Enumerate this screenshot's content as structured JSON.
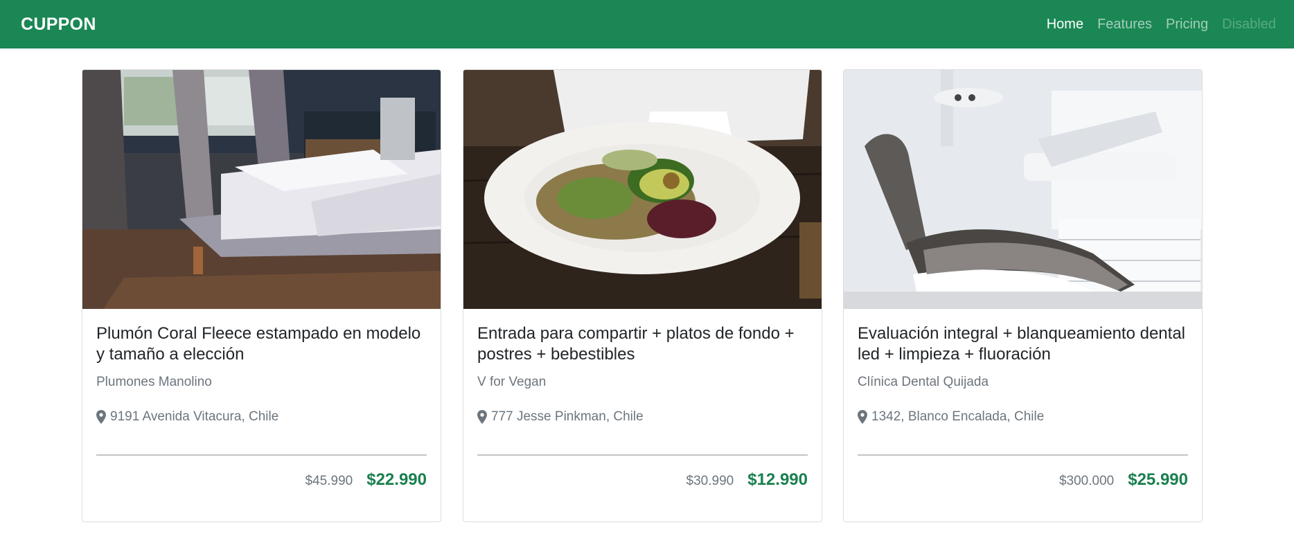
{
  "navbar": {
    "brand": "CUPPON",
    "links": [
      {
        "label": "Home",
        "state": "active"
      },
      {
        "label": "Features",
        "state": "normal"
      },
      {
        "label": "Pricing",
        "state": "normal"
      },
      {
        "label": "Disabled",
        "state": "disabled"
      }
    ],
    "background_color": "#1a8754"
  },
  "deals": [
    {
      "image": "bedroom-photo",
      "title": "Plumón Coral Fleece estampado en modelo y tamaño a elección",
      "merchant": "Plumones Manolino",
      "address": "9191 Avenida Vitacura, Chile",
      "price_old": "$45.990",
      "price_new": "$22.990"
    },
    {
      "image": "vegan-plate-photo",
      "title": "Entrada para compartir + platos de fondo + postres + bebestibles",
      "merchant": "V for Vegan",
      "address": "777 Jesse Pinkman, Chile",
      "price_old": "$30.990",
      "price_new": "$12.990"
    },
    {
      "image": "dental-chair-photo",
      "title": "Evaluación integral + blanqueamiento dental led + limpieza + fluoración",
      "merchant": "Clínica Dental Quijada",
      "address": "1342, Blanco Encalada, Chile",
      "price_old": "$300.000",
      "price_new": "$25.990"
    }
  ],
  "colors": {
    "price_new": "#1a7f4f",
    "muted_text": "#6c757d"
  }
}
